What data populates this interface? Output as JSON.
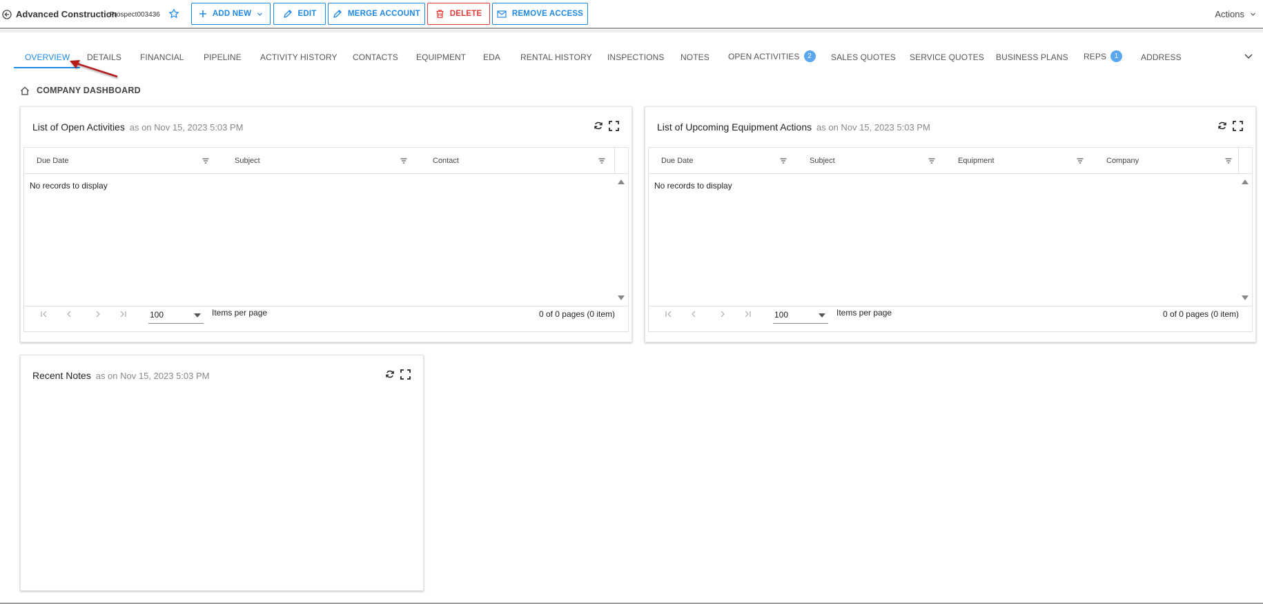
{
  "header": {
    "title": "Advanced Construction",
    "code": "Prospect003436",
    "buttons": {
      "add_new": "ADD NEW",
      "edit": "EDIT",
      "merge": "MERGE ACCOUNT",
      "delete": "DELETE",
      "remove_access": "REMOVE ACCESS"
    },
    "actions": "Actions"
  },
  "tabs": [
    {
      "label": "OVERVIEW"
    },
    {
      "label": "DETAILS"
    },
    {
      "label": "FINANCIAL"
    },
    {
      "label": "PIPELINE"
    },
    {
      "label": "ACTIVITY HISTORY"
    },
    {
      "label": "CONTACTS"
    },
    {
      "label": "EQUIPMENT"
    },
    {
      "label": "EDA"
    },
    {
      "label": "RENTAL HISTORY"
    },
    {
      "label": "INSPECTIONS"
    },
    {
      "label": "NOTES"
    },
    {
      "label": "OPEN ACTIVITIES",
      "badge": "2"
    },
    {
      "label": "SALES QUOTES"
    },
    {
      "label": "SERVICE QUOTES"
    },
    {
      "label": "BUSINESS PLANS"
    },
    {
      "label": "REPS",
      "badge": "1"
    },
    {
      "label": "ADDRESS"
    }
  ],
  "section": {
    "title": "COMPANY DASHBOARD"
  },
  "cards": {
    "activities": {
      "title": "List of Open Activities",
      "as_of": "as on Nov 15, 2023 5:03 PM",
      "columns": [
        "Due Date",
        "Subject",
        "Contact"
      ],
      "empty": "No records to display",
      "page_size": "100",
      "items_per_page": "Items per page",
      "page_info": "0 of 0 pages (0 item)"
    },
    "equipment": {
      "title": "List of Upcoming Equipment Actions",
      "as_of": "as on Nov 15, 2023 5:03 PM",
      "columns": [
        "Due Date",
        "Subject",
        "Equipment",
        "Company"
      ],
      "empty": "No records to display",
      "page_size": "100",
      "items_per_page": "Items per page",
      "page_info": "0 of 0 pages (0 item)"
    },
    "notes": {
      "title": "Recent Notes",
      "as_of": "as on Nov 15, 2023 5:03 PM"
    }
  },
  "colors": {
    "accent": "#1e88e5",
    "danger": "#e53935",
    "badge": "#5aa7ee",
    "annotation_arrow": "#b71c1c"
  }
}
